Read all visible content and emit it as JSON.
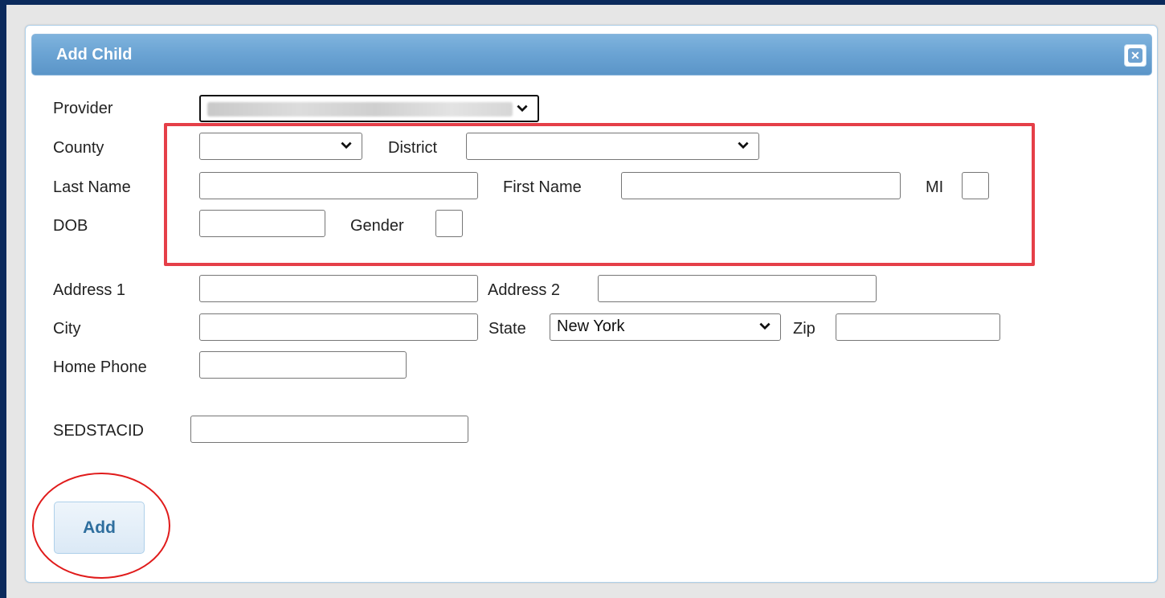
{
  "dialog": {
    "title": "Add Child",
    "close_icon": "close-icon"
  },
  "form": {
    "provider_label": "Provider",
    "provider_value": "",
    "county_label": "County",
    "county_value": "",
    "district_label": "District",
    "district_value": "",
    "last_name_label": "Last Name",
    "first_name_label": "First Name",
    "mi_label": "MI",
    "dob_label": "DOB",
    "gender_label": "Gender",
    "address1_label": "Address 1",
    "address2_label": "Address 2",
    "city_label": "City",
    "state_label": "State",
    "state_value": "New York",
    "zip_label": "Zip",
    "home_phone_label": "Home Phone",
    "sedstacid_label": "SEDSTACID"
  },
  "actions": {
    "add_label": "Add"
  },
  "colors": {
    "highlight_box": "#e53f48",
    "add_circle": "#e01b1b",
    "titlebar": "#6aa3d3"
  }
}
